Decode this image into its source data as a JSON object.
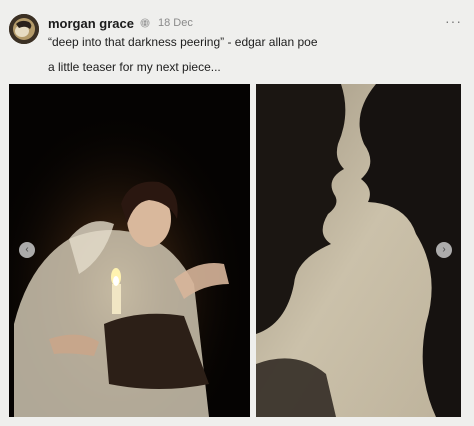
{
  "post": {
    "author": "morgan grace",
    "date": "18 Dec",
    "line1": "“deep into that darkness peering” - edgar allan poe",
    "line2": "a little teaser for my next piece...",
    "more_glyph": "···"
  },
  "icons": {
    "author_badge": "globe-icon",
    "prev": "chevron-left-icon",
    "next": "chevron-right-icon"
  },
  "carousel": {
    "prev_glyph": "‹",
    "next_glyph": "›",
    "images": [
      {
        "subject": "candlelit-woman-reading"
      },
      {
        "subject": "profile-shadows-on-wall"
      }
    ]
  },
  "colors": {
    "background": "#efefed",
    "date_text": "#8a8a8a"
  }
}
